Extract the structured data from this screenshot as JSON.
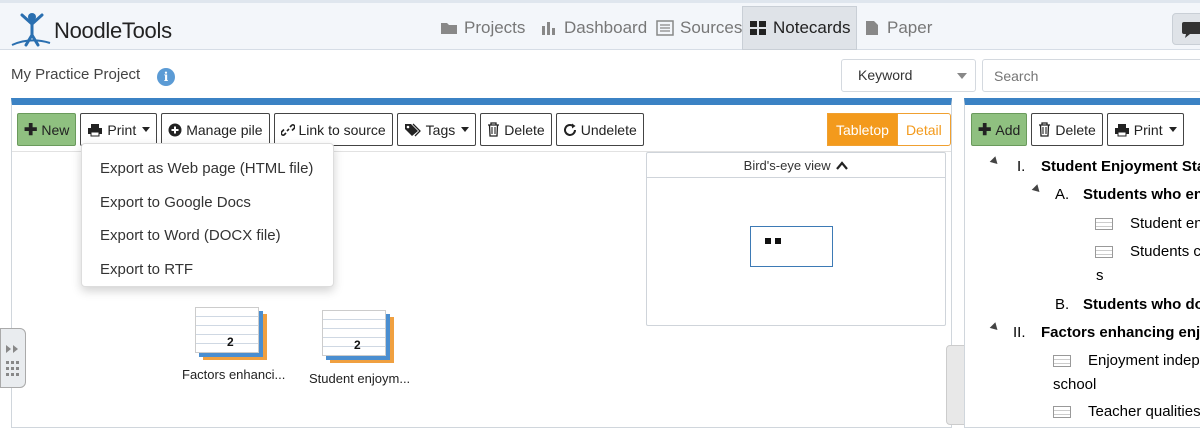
{
  "app": {
    "logo_text": "NoodleTools",
    "nav": [
      {
        "label": "Projects",
        "icon": "folder-icon"
      },
      {
        "label": "Dashboard",
        "icon": "bar-chart-icon"
      },
      {
        "label": "Sources",
        "icon": "list-icon"
      },
      {
        "label": "Notecards",
        "icon": "grid-icon",
        "active": true
      },
      {
        "label": "Paper",
        "icon": "document-icon"
      }
    ],
    "chat_icon": "chat-bubble-icon"
  },
  "subheader": {
    "project_title": "My Practice Project",
    "info_symbol": "i",
    "keyword_select": "Keyword",
    "search_placeholder": "Search"
  },
  "notecards_toolbar": {
    "new": "New",
    "print": "Print",
    "manage_pile": "Manage pile",
    "link_to_source": "Link to source",
    "tags": "Tags",
    "delete": "Delete",
    "undelete": "Undelete",
    "view_tabletop": "Tabletop",
    "view_detail": "Detail"
  },
  "print_menu": [
    "Export as Web page (HTML file)",
    "Export to Google Docs",
    "Export to Word (DOCX file)",
    "Export to RTF"
  ],
  "birds_eye": {
    "title": "Bird's-eye view"
  },
  "piles": [
    {
      "count": "2",
      "label": "Factors enhanci..."
    },
    {
      "count": "2",
      "label": "Student enjoym..."
    }
  ],
  "outline_toolbar": {
    "add": "Add",
    "delete": "Delete",
    "print": "Print"
  },
  "outline": {
    "i_num": "I.",
    "i_text": "Student Enjoyment Sta",
    "a_num": "A.",
    "a_text": "Students who en",
    "note1": "Student en",
    "note2": "Students c",
    "note2_wrap": "s",
    "b_num": "B.",
    "b_text": "Students who do",
    "ii_num": "II.",
    "ii_text": "Factors enhancing enjo",
    "note3": "Enjoyment indep",
    "note3_wrap": "school",
    "note4": "Teacher qualities"
  },
  "colors": {
    "accent_blue": "#3b82c4",
    "green_button": "#8fc080",
    "orange_toggle": "#f39a1c"
  }
}
